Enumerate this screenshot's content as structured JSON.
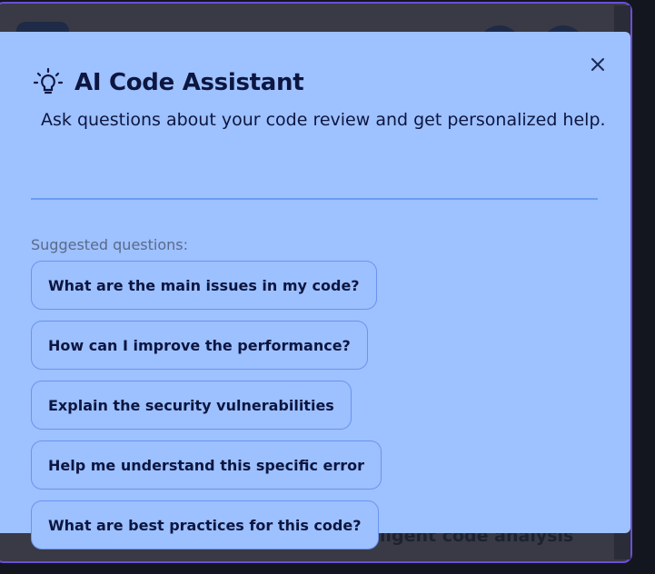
{
  "modal": {
    "title": "AI Code Assistant",
    "subtitle": "Ask questions about your code review and get personalized help.",
    "suggested_label": "Suggested questions:",
    "suggestions": [
      "What are the main issues in my code?",
      "How can I improve the performance?",
      "Explain the security vulnerabilities",
      "Help me understand this specific error",
      "What are best practices for this code?"
    ],
    "close_icon": "close-icon",
    "title_icon": "lightbulb-icon"
  },
  "background": {
    "partial_text": "ntelligent code analysis"
  },
  "colors": {
    "modal_bg": "#9ec1ff",
    "text_primary": "#0c1640",
    "accent_border": "#6b4fd6"
  }
}
